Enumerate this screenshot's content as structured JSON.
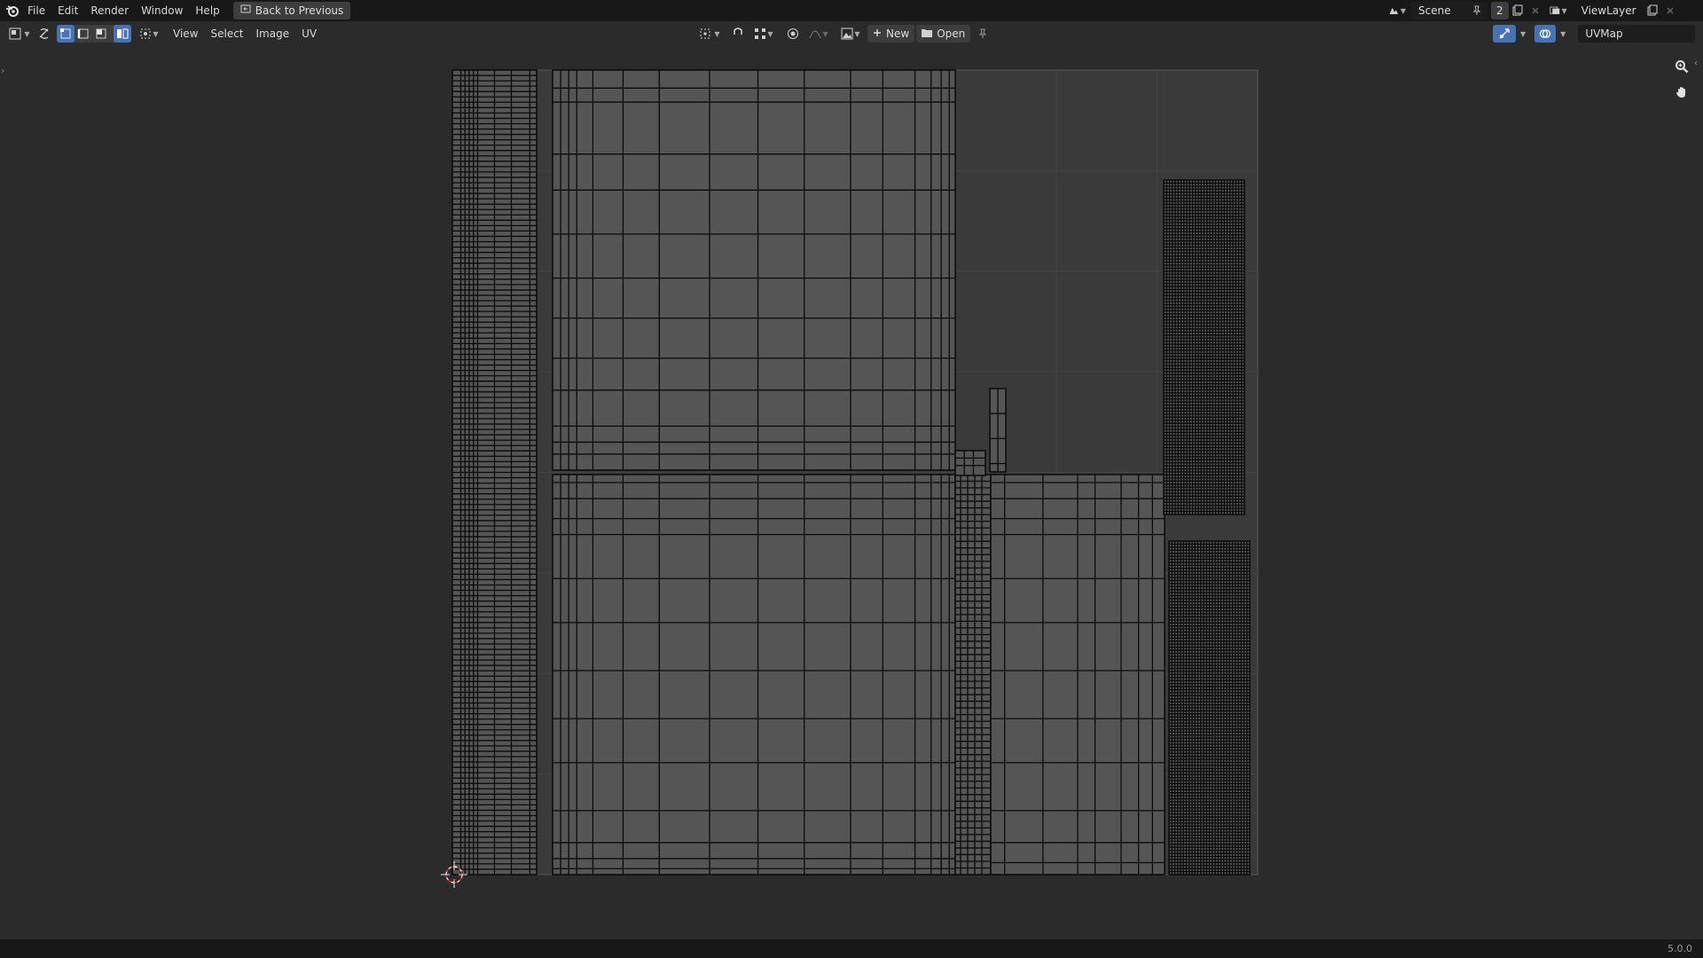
{
  "topbar": {
    "menus": [
      "File",
      "Edit",
      "Render",
      "Window",
      "Help"
    ],
    "back_label": "Back to Previous",
    "scene_name": "Scene",
    "scene_users": "2",
    "view_layer": "ViewLayer"
  },
  "header": {
    "menus": [
      "View",
      "Select",
      "Image",
      "UV"
    ],
    "new_label": "New",
    "open_label": "Open",
    "uv_map": "UVMap"
  },
  "status": {
    "version": "5.0.0"
  },
  "colors": {
    "background": "#2b2b2b",
    "topbar": "#181818",
    "accent": "#4772b3",
    "uv_face": "#555555",
    "uv_edge": "#0a0a0a",
    "cursor": "#c83030"
  },
  "icons": {
    "app": "blender-logo-icon",
    "back": "back-icon",
    "scene": "scene-icon",
    "pin": "pin-icon",
    "new_scene": "new-scene-icon",
    "close": "close-icon",
    "view_layer": "view-layer-icon",
    "editor_type": "uv-editor-icon",
    "sync": "uv-sync-icon",
    "select_modes": [
      "vertex-select-icon",
      "edge-select-icon",
      "face-select-icon",
      "island-select-icon"
    ],
    "sticky": "sticky-select-icon",
    "pivot": "pivot-icon",
    "snap": "snap-icon",
    "proportional": "proportional-edit-icon",
    "image_browse": "image-browse-icon",
    "add": "plus-icon",
    "folder": "folder-icon",
    "zoom": "zoom-icon",
    "pan": "hand-icon",
    "gizmo": "gizmo-icon",
    "overlay": "overlay-icon"
  }
}
